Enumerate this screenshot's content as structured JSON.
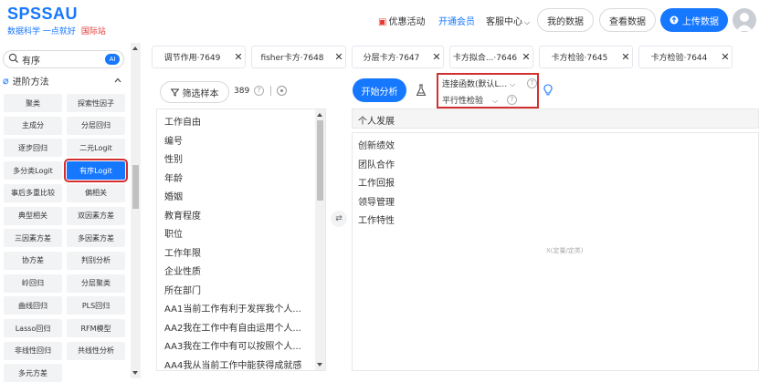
{
  "header": {
    "logo_title": "SPSSAU",
    "logo_sub": "数据科学 一点就好",
    "logo_intl": "国际站",
    "promo_icon": "gift-icon",
    "promo_label": "优惠活动",
    "vip_label": "开通会员",
    "service_label": "客服中心",
    "my_data_label": "我的数据",
    "view_data_label": "查看数据",
    "upload_label": "上传数据"
  },
  "sidebar": {
    "search_placeholder": "有序",
    "ai_badge": "AI",
    "category_label": "进阶方法",
    "methods": [
      {
        "label": "聚类"
      },
      {
        "label": "探索性因子"
      },
      {
        "label": "主成分"
      },
      {
        "label": "分层回归"
      },
      {
        "label": "逐步回归"
      },
      {
        "label": "二元Logit"
      },
      {
        "label": "多分类Logit"
      },
      {
        "label": "有序Logit",
        "active": true
      },
      {
        "label": "事后多重比较"
      },
      {
        "label": "偏相关"
      },
      {
        "label": "典型相关"
      },
      {
        "label": "双因素方差"
      },
      {
        "label": "三因素方差"
      },
      {
        "label": "多因素方差"
      },
      {
        "label": "协方差"
      },
      {
        "label": "判别分析"
      },
      {
        "label": "岭回归"
      },
      {
        "label": "分层聚类"
      },
      {
        "label": "曲线回归"
      },
      {
        "label": "PLS回归"
      },
      {
        "label": "Lasso回归"
      },
      {
        "label": "RFM模型"
      },
      {
        "label": "非线性回归"
      },
      {
        "label": "共线性分析"
      },
      {
        "label": "多元方差"
      }
    ]
  },
  "tabs": [
    {
      "label": "调节作用·7649"
    },
    {
      "label": "fisher卡方·7648"
    },
    {
      "label": "分层卡方·7647"
    },
    {
      "label": "卡方拟合...·7646"
    },
    {
      "label": "卡方检验·7645"
    },
    {
      "label": "卡方检验·7644"
    }
  ],
  "variables": {
    "filter_label": "筛选样本",
    "count": "389",
    "help": "?",
    "items": [
      "工作自由",
      "编号",
      "性别",
      "年龄",
      "婚姻",
      "教育程度",
      "职位",
      "工作年限",
      "企业性质",
      "所在部门",
      "AA1当前工作有利于发挥我个人...",
      "AA2我在工作中有自由运用个人...",
      "AA3我在工作中有可以按照个人...",
      "AA4我从当前工作中能获得成就感"
    ]
  },
  "analysis": {
    "start_label": "开始分析",
    "link_function": "连接函数(默认L...",
    "parallel_test": "平行性检验",
    "y_variable": "个人发展",
    "x_variables": [
      "创新绩效",
      "团队合作",
      "工作回报",
      "领导管理",
      "工作特性"
    ],
    "x_hint": "X(定量/定类)"
  }
}
